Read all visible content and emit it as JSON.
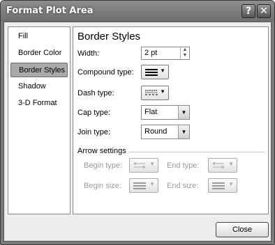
{
  "window": {
    "title": "Format Plot Area",
    "help_glyph": "?",
    "close_glyph": "✕"
  },
  "nav": {
    "items": [
      {
        "label": "Fill"
      },
      {
        "label": "Border Color"
      },
      {
        "label": "Border Styles",
        "selected": true
      },
      {
        "label": "Shadow"
      },
      {
        "label": "3-D Format"
      }
    ]
  },
  "content": {
    "heading": "Border Styles",
    "width": {
      "label": "Width:",
      "value": "2 pt"
    },
    "compound_type": {
      "label": "Compound type:",
      "icon": "compound-lines-icon"
    },
    "dash_type": {
      "label": "Dash type:",
      "icon": "dash-lines-icon"
    },
    "cap_type": {
      "label": "Cap type:",
      "value": "Flat"
    },
    "join_type": {
      "label": "Join type:",
      "value": "Round"
    },
    "arrow_settings": {
      "label": "Arrow settings",
      "begin_type": "Begin type:",
      "end_type": "End type:",
      "begin_size": "Begin size:",
      "end_size": "End size:"
    }
  },
  "buttons": {
    "close": "Close"
  },
  "colors": {
    "selected_item": "#a9a9a9",
    "title_bar": "#7b7b7b"
  }
}
